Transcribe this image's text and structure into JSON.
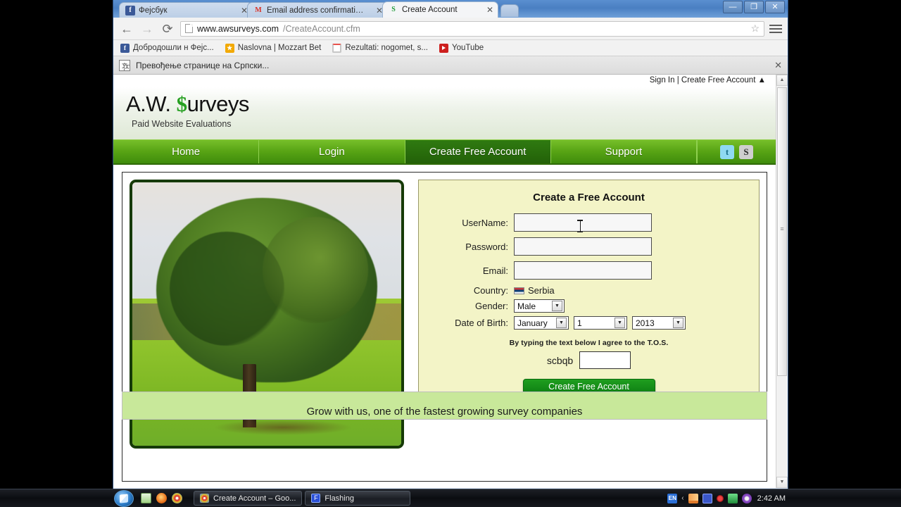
{
  "browser": {
    "tabs": [
      {
        "title": "Фејсбук",
        "favicon": "facebook-icon",
        "active": false
      },
      {
        "title": "Email address confirmation -",
        "favicon": "gmail-icon",
        "active": false
      },
      {
        "title": "Create Account",
        "favicon": "awsurveys-icon",
        "active": true
      }
    ],
    "window_controls": {
      "minimize": "—",
      "maximize": "❐",
      "close": "✕"
    },
    "toolbar": {
      "back": "←",
      "forward": "→",
      "reload": "⟳",
      "url_strong": "www.awsurveys.com",
      "url_rest": "/CreateAccount.cfm",
      "star": "☆",
      "menu": "menu-icon"
    },
    "bookmarks": [
      {
        "label": "Добродошли н   Фејс...",
        "icon": "facebook-icon"
      },
      {
        "label": "Naslovna | Mozzart Bet",
        "icon": "mozzart-icon"
      },
      {
        "label": "Rezultati: nogomet, s...",
        "icon": "loading-icon"
      },
      {
        "label": "YouTube",
        "icon": "youtube-icon"
      }
    ],
    "translate_bar": {
      "icon": "translate-icon",
      "text": "Превођење странице на Српски...",
      "close": "✕"
    },
    "scrollbar": {
      "up": "▲",
      "down": "▼",
      "grip": "≡"
    }
  },
  "site": {
    "signbar": {
      "sign_in": "Sign In",
      "separator": "|",
      "create_account": "Create Free Account",
      "collapse": "▲"
    },
    "logo": {
      "pre": "A.W. ",
      "dollar": "$",
      "post": "urveys"
    },
    "tagline": "Paid Website Evaluations",
    "nav": [
      {
        "label": "Home",
        "active": false
      },
      {
        "label": "Login",
        "active": false
      },
      {
        "label": "Create Free Account",
        "active": true
      },
      {
        "label": "Support",
        "active": false
      }
    ],
    "social": [
      {
        "name": "twitter-icon",
        "glyph": "t"
      },
      {
        "name": "skype-icon",
        "glyph": "S"
      }
    ],
    "banner": "Grow with us, one of the fastest growing survey companies"
  },
  "form": {
    "title": "Create a Free Account",
    "username": {
      "label": "UserName:",
      "value": ""
    },
    "password": {
      "label": "Password:",
      "value": ""
    },
    "email": {
      "label": "Email:",
      "value": ""
    },
    "country": {
      "label": "Country:",
      "value": "Serbia",
      "flag": "serbia-flag-icon"
    },
    "gender": {
      "label": "Gender:",
      "value": "Male",
      "caret": "▼"
    },
    "dob": {
      "label": "Date of Birth:",
      "month": "January",
      "day": "1",
      "year": "2013",
      "caret": "▼"
    },
    "tos_text": "By typing the text below I agree to the T.O.S.",
    "captcha_code": "scbqb",
    "captcha_value": "",
    "submit_label": "Create Free Account"
  },
  "taskbar": {
    "start": "windows-start-orb",
    "quicklaunch": [
      "notes-icon",
      "firefox-icon",
      "chrome-icon"
    ],
    "windows": [
      {
        "label": "Create Account – Goo...",
        "icon": "chrome-icon"
      },
      {
        "label": "Flashing",
        "icon": "flash-icon"
      }
    ],
    "tray": {
      "language": "EN",
      "chevron": "‹",
      "icons": [
        "signal-icon",
        "network-icon",
        "alert-icon",
        "chart-icon",
        "antivirus-icon"
      ],
      "clock": "2:42 AM"
    }
  },
  "colors": {
    "nav_green": "#57a314",
    "nav_active_green": "#2f7a11",
    "form_bg": "#f3f4c7",
    "submit_green": "#1f9e1f",
    "banner_green": "#c8e89a",
    "logo_dollar": "#27a022"
  }
}
